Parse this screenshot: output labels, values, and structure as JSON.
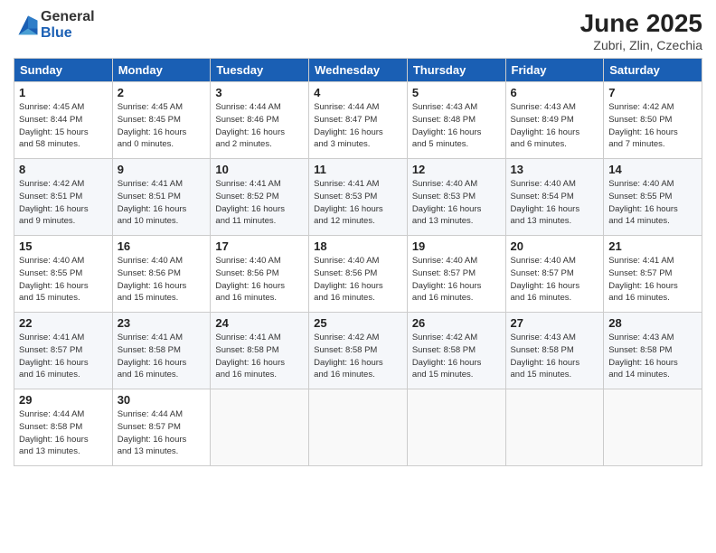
{
  "logo": {
    "text_general": "General",
    "text_blue": "Blue"
  },
  "title": {
    "month": "June 2025",
    "location": "Zubri, Zlin, Czechia"
  },
  "days_of_week": [
    "Sunday",
    "Monday",
    "Tuesday",
    "Wednesday",
    "Thursday",
    "Friday",
    "Saturday"
  ],
  "weeks": [
    [
      {
        "day": "1",
        "info": "Sunrise: 4:45 AM\nSunset: 8:44 PM\nDaylight: 15 hours\nand 58 minutes."
      },
      {
        "day": "2",
        "info": "Sunrise: 4:45 AM\nSunset: 8:45 PM\nDaylight: 16 hours\nand 0 minutes."
      },
      {
        "day": "3",
        "info": "Sunrise: 4:44 AM\nSunset: 8:46 PM\nDaylight: 16 hours\nand 2 minutes."
      },
      {
        "day": "4",
        "info": "Sunrise: 4:44 AM\nSunset: 8:47 PM\nDaylight: 16 hours\nand 3 minutes."
      },
      {
        "day": "5",
        "info": "Sunrise: 4:43 AM\nSunset: 8:48 PM\nDaylight: 16 hours\nand 5 minutes."
      },
      {
        "day": "6",
        "info": "Sunrise: 4:43 AM\nSunset: 8:49 PM\nDaylight: 16 hours\nand 6 minutes."
      },
      {
        "day": "7",
        "info": "Sunrise: 4:42 AM\nSunset: 8:50 PM\nDaylight: 16 hours\nand 7 minutes."
      }
    ],
    [
      {
        "day": "8",
        "info": "Sunrise: 4:42 AM\nSunset: 8:51 PM\nDaylight: 16 hours\nand 9 minutes."
      },
      {
        "day": "9",
        "info": "Sunrise: 4:41 AM\nSunset: 8:51 PM\nDaylight: 16 hours\nand 10 minutes."
      },
      {
        "day": "10",
        "info": "Sunrise: 4:41 AM\nSunset: 8:52 PM\nDaylight: 16 hours\nand 11 minutes."
      },
      {
        "day": "11",
        "info": "Sunrise: 4:41 AM\nSunset: 8:53 PM\nDaylight: 16 hours\nand 12 minutes."
      },
      {
        "day": "12",
        "info": "Sunrise: 4:40 AM\nSunset: 8:53 PM\nDaylight: 16 hours\nand 13 minutes."
      },
      {
        "day": "13",
        "info": "Sunrise: 4:40 AM\nSunset: 8:54 PM\nDaylight: 16 hours\nand 13 minutes."
      },
      {
        "day": "14",
        "info": "Sunrise: 4:40 AM\nSunset: 8:55 PM\nDaylight: 16 hours\nand 14 minutes."
      }
    ],
    [
      {
        "day": "15",
        "info": "Sunrise: 4:40 AM\nSunset: 8:55 PM\nDaylight: 16 hours\nand 15 minutes."
      },
      {
        "day": "16",
        "info": "Sunrise: 4:40 AM\nSunset: 8:56 PM\nDaylight: 16 hours\nand 15 minutes."
      },
      {
        "day": "17",
        "info": "Sunrise: 4:40 AM\nSunset: 8:56 PM\nDaylight: 16 hours\nand 16 minutes."
      },
      {
        "day": "18",
        "info": "Sunrise: 4:40 AM\nSunset: 8:56 PM\nDaylight: 16 hours\nand 16 minutes."
      },
      {
        "day": "19",
        "info": "Sunrise: 4:40 AM\nSunset: 8:57 PM\nDaylight: 16 hours\nand 16 minutes."
      },
      {
        "day": "20",
        "info": "Sunrise: 4:40 AM\nSunset: 8:57 PM\nDaylight: 16 hours\nand 16 minutes."
      },
      {
        "day": "21",
        "info": "Sunrise: 4:41 AM\nSunset: 8:57 PM\nDaylight: 16 hours\nand 16 minutes."
      }
    ],
    [
      {
        "day": "22",
        "info": "Sunrise: 4:41 AM\nSunset: 8:57 PM\nDaylight: 16 hours\nand 16 minutes."
      },
      {
        "day": "23",
        "info": "Sunrise: 4:41 AM\nSunset: 8:58 PM\nDaylight: 16 hours\nand 16 minutes."
      },
      {
        "day": "24",
        "info": "Sunrise: 4:41 AM\nSunset: 8:58 PM\nDaylight: 16 hours\nand 16 minutes."
      },
      {
        "day": "25",
        "info": "Sunrise: 4:42 AM\nSunset: 8:58 PM\nDaylight: 16 hours\nand 16 minutes."
      },
      {
        "day": "26",
        "info": "Sunrise: 4:42 AM\nSunset: 8:58 PM\nDaylight: 16 hours\nand 15 minutes."
      },
      {
        "day": "27",
        "info": "Sunrise: 4:43 AM\nSunset: 8:58 PM\nDaylight: 16 hours\nand 15 minutes."
      },
      {
        "day": "28",
        "info": "Sunrise: 4:43 AM\nSunset: 8:58 PM\nDaylight: 16 hours\nand 14 minutes."
      }
    ],
    [
      {
        "day": "29",
        "info": "Sunrise: 4:44 AM\nSunset: 8:58 PM\nDaylight: 16 hours\nand 13 minutes."
      },
      {
        "day": "30",
        "info": "Sunrise: 4:44 AM\nSunset: 8:57 PM\nDaylight: 16 hours\nand 13 minutes."
      },
      null,
      null,
      null,
      null,
      null
    ]
  ]
}
